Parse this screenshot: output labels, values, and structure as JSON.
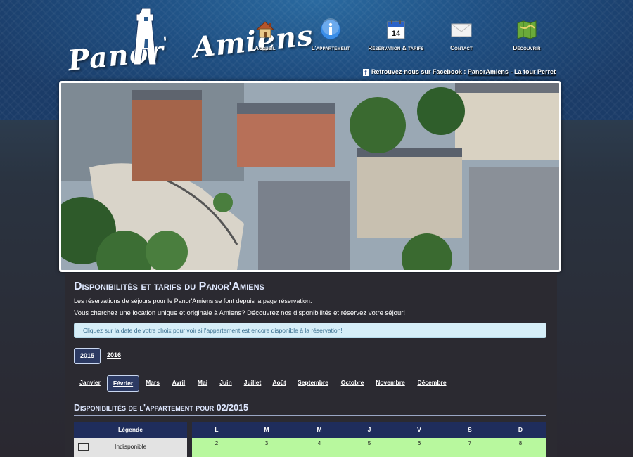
{
  "logo": {
    "text_left": "Panor",
    "text_apostrophe": "'",
    "text_right": "Amiens"
  },
  "nav": [
    {
      "label": "Accueil",
      "icon": "house-icon"
    },
    {
      "label": "L'appartement",
      "icon": "info-icon"
    },
    {
      "label": "Réservation & tarifs",
      "icon": "calendar-icon",
      "badge": "14"
    },
    {
      "label": "Contact",
      "icon": "envelope-icon"
    },
    {
      "label": "Découvrir",
      "icon": "map-icon"
    }
  ],
  "facebook": {
    "text": "Retrouvez-nous sur Facebook :",
    "link1": "PanorAmiens",
    "separator": "-",
    "link2": "La tour Perret"
  },
  "content": {
    "title": "Disponibilités et tarifs du Panor'Amiens",
    "p1_text": "Les réservations de séjours pour le Panor'Amiens se font depuis",
    "p1_link": "la page réservation",
    "p1_end": ".",
    "p2": "Vous cherchez une location unique et originale à Amiens? Découvrez nos disponibilités et réservez votre séjour!",
    "alert": "Cliquez sur la date de votre choix pour voir si l'appartement est encore disponible à la réservation!"
  },
  "years": [
    {
      "label": "2015",
      "active": true
    },
    {
      "label": "2016",
      "active": false
    }
  ],
  "months": [
    {
      "label": "Janvier",
      "active": false
    },
    {
      "label": "Février",
      "active": true
    },
    {
      "label": "Mars",
      "active": false
    },
    {
      "label": "Avril",
      "active": false
    },
    {
      "label": "Mai",
      "active": false
    },
    {
      "label": "Juin",
      "active": false
    },
    {
      "label": "Juillet",
      "active": false
    },
    {
      "label": "Août",
      "active": false
    },
    {
      "label": "Septembre",
      "active": false
    },
    {
      "label": "Octobre",
      "active": false
    },
    {
      "label": "Novembre",
      "active": false
    },
    {
      "label": "Décembre",
      "active": false
    }
  ],
  "availability": {
    "title": "Disponibilités de l'appartement pour 02/2015",
    "legend_header": "Légende",
    "legend_items": [
      {
        "label": "Indisponible"
      }
    ],
    "weekdays": [
      "L",
      "M",
      "M",
      "J",
      "V",
      "S",
      "D"
    ],
    "first_row": [
      "2",
      "3",
      "4",
      "5",
      "6",
      "7",
      "8"
    ],
    "available_color": "#b8f89e"
  },
  "colors": {
    "header_blue": "#1f4f82",
    "content_bg": "#2b2a31",
    "table_header": "#1f2d5c",
    "alert_bg": "#d6eef8"
  }
}
